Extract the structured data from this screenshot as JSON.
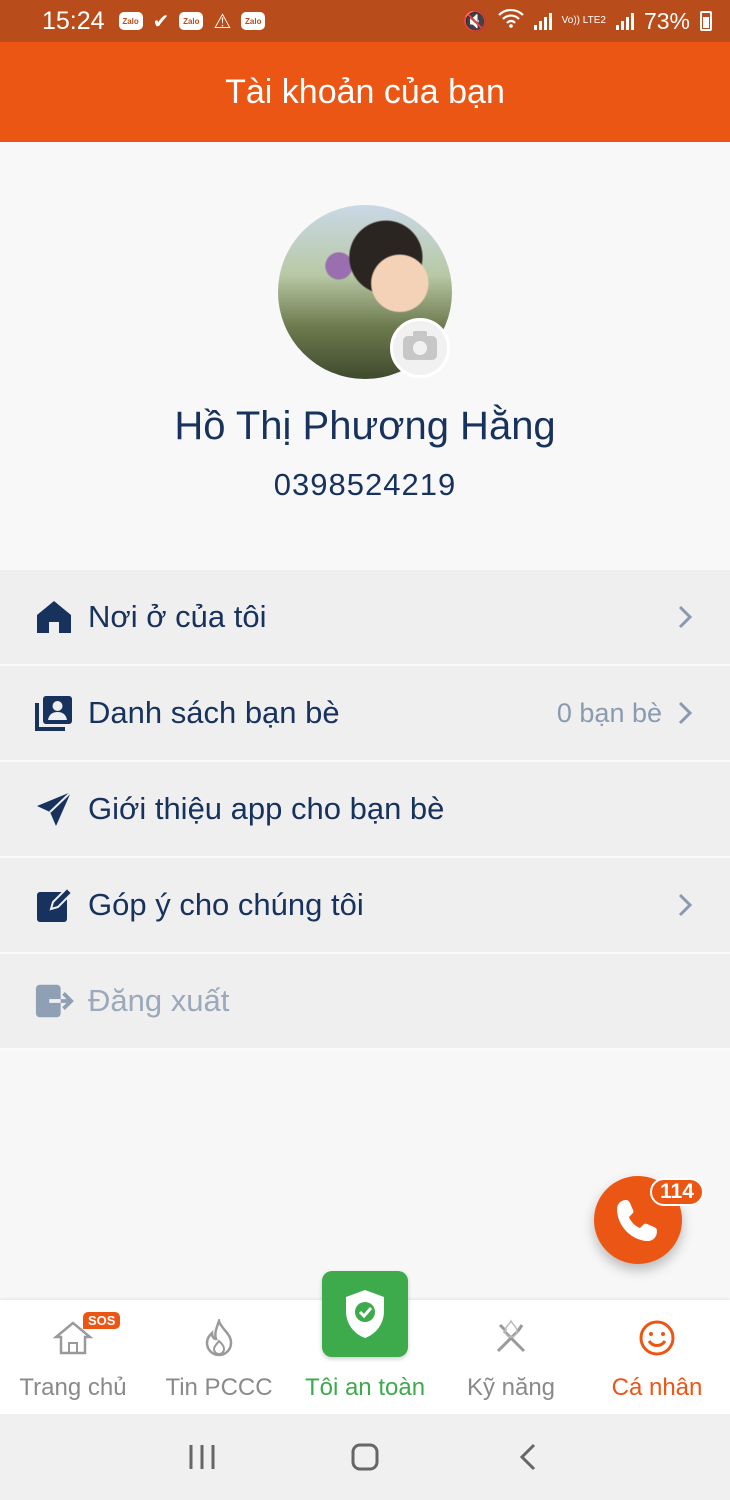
{
  "status_bar": {
    "time": "15:24",
    "notifications": [
      "zalo-icon",
      "download-done-icon",
      "zalo-icon",
      "warning-icon",
      "zalo-icon"
    ],
    "zalo_text": "Zalo",
    "battery": "73%",
    "network_label": "Vo)) LTE2"
  },
  "header": {
    "title": "Tài khoản của bạn"
  },
  "profile": {
    "name": "Hồ Thị Phương Hằng",
    "phone": "0398524219"
  },
  "menu": [
    {
      "label": "Nơi ở của tôi",
      "icon": "home-icon",
      "value": "",
      "chevron": true,
      "disabled": false
    },
    {
      "label": "Danh sách bạn bè",
      "icon": "contacts-icon",
      "value": "0 bạn bè",
      "chevron": true,
      "disabled": false
    },
    {
      "label": "Giới thiệu app cho bạn bè",
      "icon": "send-icon",
      "value": "",
      "chevron": false,
      "disabled": false
    },
    {
      "label": "Góp ý cho chúng tôi",
      "icon": "edit-icon",
      "value": "",
      "chevron": true,
      "disabled": false
    },
    {
      "label": "Đăng xuất",
      "icon": "logout-icon",
      "value": "",
      "chevron": false,
      "disabled": true
    }
  ],
  "call_button": {
    "badge": "114"
  },
  "bottom_nav": [
    {
      "label": "Trang chủ",
      "icon": "home-outline-icon",
      "badge": "SOS"
    },
    {
      "label": "Tin PCCC",
      "icon": "fire-icon"
    },
    {
      "label": "Tôi an toàn",
      "icon": "shield-check-icon"
    },
    {
      "label": "Kỹ năng",
      "icon": "tools-icon"
    },
    {
      "label": "Cá nhân",
      "icon": "smile-icon"
    }
  ],
  "colors": {
    "primary": "#ec5615",
    "status_bar": "#b84c1a",
    "text_dark": "#17325c",
    "safe_green": "#3daa4b",
    "inactive": "#8a8a8a"
  }
}
